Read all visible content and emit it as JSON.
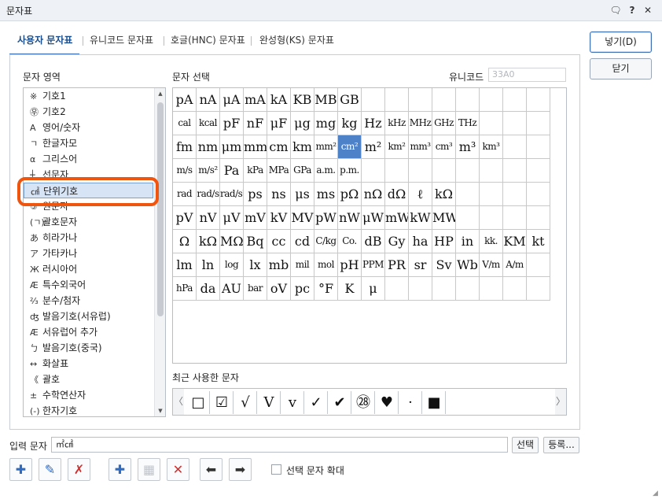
{
  "window": {
    "title": "문자표",
    "buttons": [
      {
        "name": "restore-icon",
        "glyph": "🗨"
      },
      {
        "name": "help-button",
        "glyph": "?"
      },
      {
        "name": "close-icon",
        "glyph": "✕"
      }
    ]
  },
  "tabs": [
    {
      "label": "사용자 문자표",
      "active": true
    },
    {
      "label": "유니코드 문자표",
      "active": false
    },
    {
      "label": "호글(HNC) 문자표",
      "active": false
    },
    {
      "label": "완성형(KS) 문자표",
      "active": false
    }
  ],
  "side_buttons": {
    "insert": "넣기(D)",
    "close": "닫기"
  },
  "area": {
    "label": "문자 영역",
    "items": [
      {
        "icon": "※",
        "label": "기호1"
      },
      {
        "icon": "㉾",
        "label": "기호2"
      },
      {
        "icon": "A",
        "label": "영어/숫자"
      },
      {
        "icon": "ㄱ",
        "label": "한글자모"
      },
      {
        "icon": "α",
        "label": "그리스어"
      },
      {
        "icon": "┼",
        "label": "선문자"
      },
      {
        "icon": "㎠",
        "label": "단위기호"
      },
      {
        "icon": "⑤",
        "label": "원문자"
      },
      {
        "icon": "(ㄱ)",
        "label": "괄호문자"
      },
      {
        "icon": "あ",
        "label": "히라가나"
      },
      {
        "icon": "ア",
        "label": "가타카나"
      },
      {
        "icon": "Ж",
        "label": "러시아어"
      },
      {
        "icon": "Æ",
        "label": "특수외국어"
      },
      {
        "icon": "⅔",
        "label": "분수/첨자"
      },
      {
        "icon": "ʤ",
        "label": "발음기호(서유럽)"
      },
      {
        "icon": "Æ",
        "label": "서유럽어 추가"
      },
      {
        "icon": "ㄅ",
        "label": "발음기호(중국)"
      },
      {
        "icon": "↔",
        "label": "화살표"
      },
      {
        "icon": "《",
        "label": "괄호"
      },
      {
        "icon": "±",
        "label": "수학연산자"
      },
      {
        "icon": "(-)",
        "label": "한자기호"
      }
    ],
    "selected_index": 6
  },
  "selection": {
    "label": "문자 선택",
    "unicode_label": "유니코드",
    "unicode_value": "33A0"
  },
  "chars": [
    [
      "pA",
      "nA",
      "μA",
      "mA",
      "kA",
      "KB",
      "MB",
      "GB",
      "",
      "",
      "",
      "",
      "",
      "",
      "",
      ""
    ],
    [
      "cal",
      "kcal",
      "pF",
      "nF",
      "μF",
      "μg",
      "mg",
      "kg",
      "Hz",
      "kHz",
      "MHz",
      "GHz",
      "THz",
      "",
      "",
      ""
    ],
    [
      "fm",
      "nm",
      "μm",
      "mm",
      "cm",
      "km",
      "mm²",
      "cm²",
      "m²",
      "km²",
      "mm³",
      "cm³",
      "m³",
      "km³",
      "",
      ""
    ],
    [
      "m∕s",
      "m∕s²",
      "Pa",
      "kPa",
      "MPa",
      "GPa",
      "a.m.",
      "p.m.",
      "",
      "",
      "",
      "",
      "",
      "",
      "",
      ""
    ],
    [
      "rad",
      "rad∕s",
      "rad∕s²",
      "ps",
      "ns",
      "μs",
      "ms",
      "pΩ",
      "nΩ",
      "dΩ",
      "ℓ",
      "kΩ",
      "",
      "",
      "",
      ""
    ],
    [
      "pV",
      "nV",
      "μV",
      "mV",
      "kV",
      "MV",
      "pW",
      "nW",
      "μW",
      "mW",
      "kW",
      "MW",
      "",
      "",
      "",
      ""
    ],
    [
      "Ω",
      "kΩ",
      "MΩ",
      "Bq",
      "cc",
      "cd",
      "C∕kg",
      "Co.",
      "dB",
      "Gy",
      "ha",
      "HP",
      "in",
      "kk.",
      "KM",
      "kt"
    ],
    [
      "lm",
      "ln",
      "log",
      "lx",
      "mb",
      "mil",
      "mol",
      "pH",
      "PPM",
      "PR",
      "sr",
      "Sv",
      "Wb",
      "V∕m",
      "A∕m",
      ""
    ],
    [
      "hPa",
      "da",
      "AU",
      "bar",
      "oV",
      "pc",
      "°F",
      "K",
      "μ",
      "",
      "",
      "",
      "",
      "",
      "",
      ""
    ]
  ],
  "selected_char": {
    "row": 2,
    "col": 7
  },
  "recent": {
    "label": "최근 사용한 문자",
    "items": [
      "□",
      "☑",
      "√",
      "V",
      "v",
      "✓",
      "✔",
      "㉘",
      "♥",
      "·",
      "■"
    ],
    "prev": "〈",
    "next": "〉"
  },
  "input": {
    "label": "입력 문자",
    "value": "㎡㎠",
    "select_button": "선택",
    "register_button": "등록..."
  },
  "tools": [
    {
      "name": "add-char-icon",
      "glyph": "✚"
    },
    {
      "name": "edit-char-icon",
      "glyph": "✎"
    },
    {
      "name": "delete-char-icon",
      "glyph": "✗"
    },
    {
      "name": "add-icon",
      "glyph": "✚"
    },
    {
      "name": "table-icon",
      "glyph": "▦"
    },
    {
      "name": "remove-icon",
      "glyph": "✕"
    },
    {
      "name": "arrow-left-icon",
      "glyph": "⬅"
    },
    {
      "name": "arrow-right-icon",
      "glyph": "➡"
    }
  ],
  "zoom_checkbox": {
    "label": "선택 문자 확대",
    "checked": false
  },
  "colors": {
    "accent": "#3c6fb5",
    "selected_cell": "#4d82c9",
    "highlight_ring": "#f0550f",
    "delete_red": "#d92b2b",
    "tool_blue": "#2e6bc4"
  }
}
